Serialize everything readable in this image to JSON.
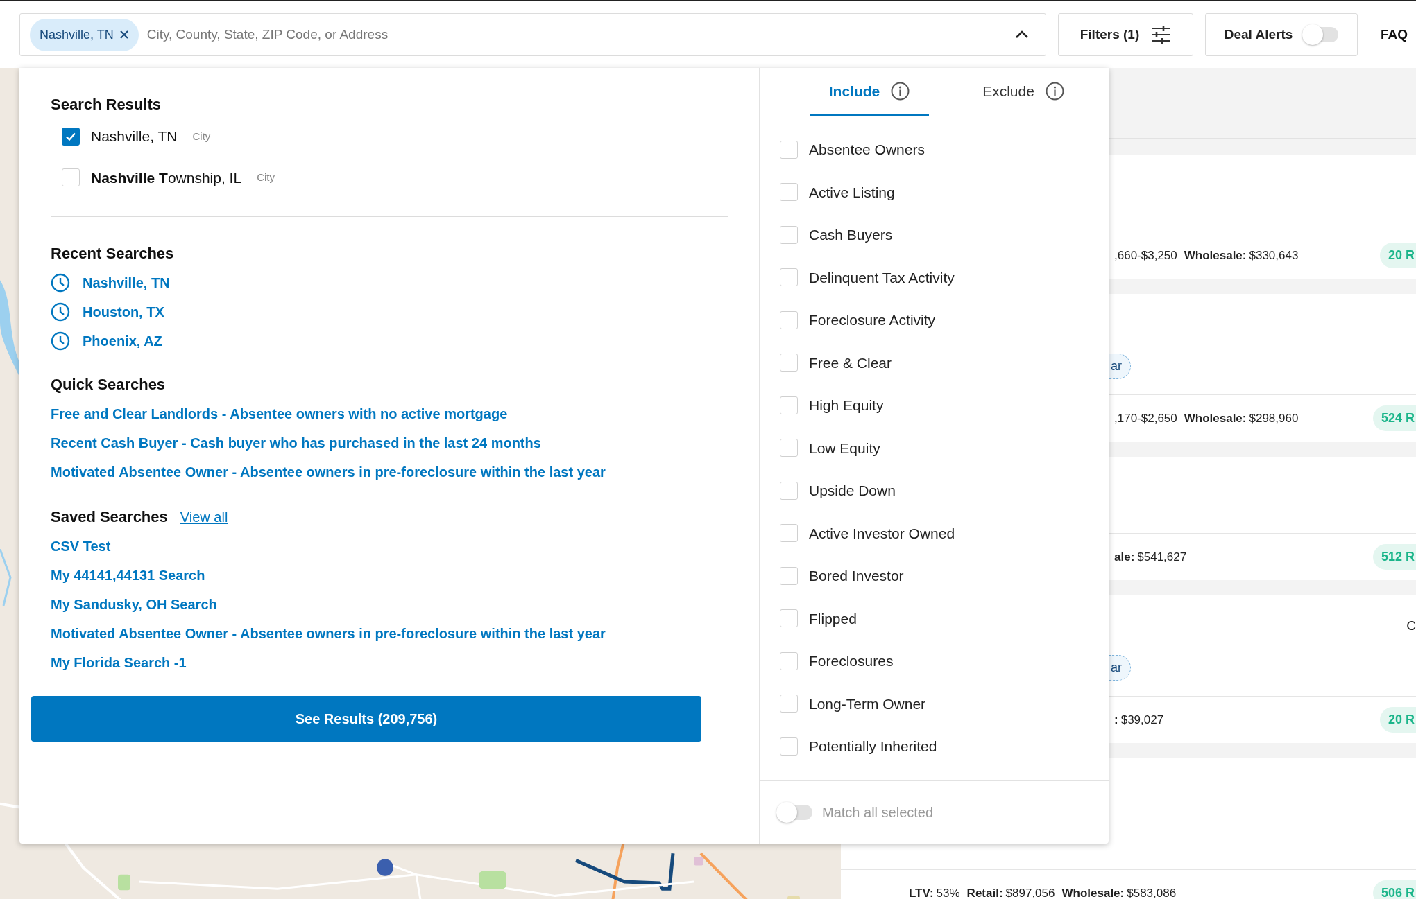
{
  "search": {
    "chip": "Nashville, TN",
    "placeholder": "City, County, State, ZIP Code, or Address",
    "expanded": true
  },
  "filters_button": "Filters (1)",
  "deal_alerts": {
    "label": "Deal Alerts",
    "on": false
  },
  "faq": "FAQ",
  "search_results": {
    "title": "Search Results",
    "items": [
      {
        "name": "Nashville, TN",
        "type": "City",
        "checked": true
      },
      {
        "name": "**Nashville T**ownship, IL",
        "type": "City",
        "checked": false
      }
    ]
  },
  "recent_searches": {
    "title": "Recent Searches",
    "items": [
      "Nashville, TN",
      "Houston, TX",
      "Phoenix, AZ"
    ]
  },
  "quick_searches": {
    "title": "Quick Searches",
    "items": [
      "Free and Clear Landlords - Absentee owners with no active mortgage",
      "Recent Cash Buyer - Cash buyer who has purchased in the last 24 months",
      "Motivated Absentee Owner - Absentee owners in pre-foreclosure within the last year"
    ]
  },
  "saved_searches": {
    "title": "Saved Searches",
    "view_all": "View all",
    "items": [
      "CSV Test",
      "My 44141,44131 Search",
      "My Sandusky, OH Search",
      "Motivated Absentee Owner - Absentee owners in pre-foreclosure within the last year",
      "My Florida Search -1"
    ]
  },
  "see_results": "See Results (209,756)",
  "tabs": [
    {
      "label": "Include",
      "selected": true
    },
    {
      "label": "Exclude",
      "selected": false
    }
  ],
  "filters": [
    {
      "label": "Absentee Owners",
      "checked": false
    },
    {
      "label": "Active Listing",
      "checked": false
    },
    {
      "label": "Cash Buyers",
      "checked": false
    },
    {
      "label": "Delinquent Tax Activity",
      "checked": false
    },
    {
      "label": "Foreclosure Activity",
      "checked": false
    },
    {
      "label": "Free & Clear",
      "checked": false
    },
    {
      "label": "High Equity",
      "checked": false
    },
    {
      "label": "Low Equity",
      "checked": false
    },
    {
      "label": "Upside Down",
      "checked": false
    },
    {
      "label": "Active Investor Owned",
      "checked": false
    },
    {
      "label": "Bored Investor",
      "checked": false
    },
    {
      "label": "Flipped",
      "checked": false
    },
    {
      "label": "Foreclosures",
      "checked": false
    },
    {
      "label": "Long-Term Owner",
      "checked": false
    },
    {
      "label": "Potentially Inherited",
      "checked": false
    }
  ],
  "match_all": {
    "label": "Match all selected",
    "on": false
  },
  "listings": [
    {
      "kind": "covered",
      "metrics": [
        {
          "value": ",660-$3,250"
        },
        {
          "label": "Wholesale:",
          "value": "$330,643"
        }
      ],
      "badge": "20 R"
    },
    {
      "kind": "covered",
      "tag": "ar",
      "metrics": [
        {
          "value": ",170-$2,650"
        },
        {
          "label": "Wholesale:",
          "value": "$298,960"
        }
      ],
      "badge": "524 R"
    },
    {
      "kind": "covered",
      "metrics": [
        {
          "label": "ale:",
          "value": "$541,627"
        }
      ],
      "badge": "512 R"
    },
    {
      "kind": "covered",
      "side": "C",
      "tag": "ar",
      "metrics": [
        {
          "label": ":",
          "value": "$39,027"
        }
      ],
      "badge": "20 R"
    },
    {
      "kind": "full",
      "metrics": [
        {
          "label": "LTV:",
          "value": "53%"
        },
        {
          "label": "Retail:",
          "value": "$897,056"
        },
        {
          "label": "Wholesale:",
          "value": "$583,086"
        }
      ],
      "badge": "506 R"
    }
  ]
}
